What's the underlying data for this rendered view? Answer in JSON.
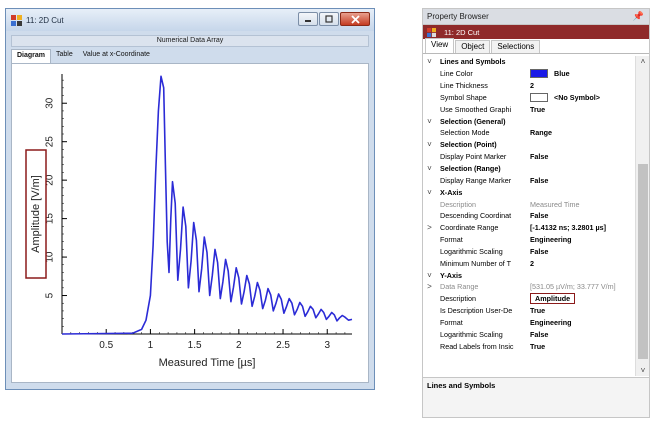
{
  "window": {
    "title": "11: 2D Cut",
    "subtitle": "Numerical Data Array",
    "tabs": [
      "Diagram",
      "Table",
      "Value at x-Coordinate"
    ],
    "active_tab": 0
  },
  "chart_data": {
    "type": "line",
    "xlabel": "Measured Time [µs]",
    "ylabel": "Amplitude [V/m]",
    "xlim": [
      0.0,
      3.28
    ],
    "ylim": [
      0.0,
      33.8
    ],
    "xticks": [
      "0.5",
      "1",
      "1.5",
      "2",
      "2.5",
      "3"
    ],
    "xtick_values": [
      0.5,
      1,
      1.5,
      2,
      2.5,
      3
    ],
    "yticks": [
      "5",
      "10",
      "15",
      "20",
      "25",
      "30"
    ],
    "ytick_values": [
      5,
      10,
      15,
      20,
      25,
      30
    ],
    "series": [
      {
        "color": "#2b2bd6",
        "x": [
          0.0,
          0.8,
          0.9,
          0.95,
          1.0,
          1.03,
          1.06,
          1.09,
          1.12,
          1.15,
          1.17,
          1.19,
          1.21,
          1.23,
          1.25,
          1.28,
          1.31,
          1.34,
          1.37,
          1.4,
          1.43,
          1.46,
          1.49,
          1.52,
          1.55,
          1.58,
          1.61,
          1.64,
          1.67,
          1.7,
          1.73,
          1.76,
          1.79,
          1.82,
          1.85,
          1.88,
          1.91,
          1.94,
          1.97,
          2.0,
          2.03,
          2.06,
          2.09,
          2.12,
          2.15,
          2.18,
          2.21,
          2.24,
          2.27,
          2.3,
          2.33,
          2.36,
          2.39,
          2.42,
          2.45,
          2.48,
          2.51,
          2.54,
          2.57,
          2.6,
          2.63,
          2.66,
          2.69,
          2.72,
          2.75,
          2.78,
          2.81,
          2.84,
          2.87,
          2.9,
          2.93,
          2.96,
          2.99,
          3.02,
          3.05,
          3.08,
          3.11,
          3.14,
          3.17,
          3.2,
          3.24,
          3.28
        ],
        "y": [
          0.0,
          0.1,
          0.6,
          1.8,
          5.0,
          11.5,
          21.0,
          29.0,
          33.5,
          32.0,
          22.0,
          12.0,
          8.0,
          15.0,
          19.8,
          17.0,
          7.0,
          11.0,
          16.5,
          14.0,
          6.0,
          9.5,
          14.5,
          12.2,
          5.5,
          8.5,
          12.6,
          10.6,
          5.0,
          7.6,
          11.0,
          9.3,
          4.6,
          6.8,
          9.7,
          8.2,
          4.2,
          6.1,
          8.6,
          7.3,
          3.9,
          5.5,
          7.6,
          6.5,
          3.6,
          4.9,
          6.7,
          5.7,
          3.3,
          4.4,
          5.9,
          5.1,
          3.0,
          4.0,
          5.2,
          4.5,
          2.7,
          3.6,
          4.6,
          4.0,
          2.5,
          3.2,
          4.1,
          3.6,
          2.3,
          2.9,
          3.6,
          3.2,
          2.1,
          2.6,
          3.2,
          2.8,
          1.9,
          2.3,
          2.8,
          2.5,
          1.7,
          2.1,
          2.4,
          2.2,
          1.8,
          1.9
        ]
      }
    ]
  },
  "property_browser": {
    "title": "Property Browser",
    "pin": "📌",
    "object_name": "11: 2D Cut",
    "tabs": [
      "View",
      "Object",
      "Selections"
    ],
    "active_tab": 0,
    "rows": [
      {
        "kind": "cat",
        "exp": "˅",
        "name": "Lines and Symbols"
      },
      {
        "kind": "prop",
        "name": "Line Color",
        "value": "Blue",
        "swatch": "#1a1ae6"
      },
      {
        "kind": "prop",
        "name": "Line Thickness",
        "value": "2"
      },
      {
        "kind": "prop",
        "name": "Symbol Shape",
        "value": "<No Symbol>",
        "swatch": "#ffffff"
      },
      {
        "kind": "prop",
        "name": "Use Smoothed Graphi",
        "value": "True"
      },
      {
        "kind": "cat",
        "exp": "˅",
        "name": "Selection (General)"
      },
      {
        "kind": "prop",
        "name": "Selection Mode",
        "value": "Range"
      },
      {
        "kind": "cat",
        "exp": "˅",
        "name": "Selection (Point)"
      },
      {
        "kind": "prop",
        "name": "Display Point Marker",
        "value": "False"
      },
      {
        "kind": "cat",
        "exp": "˅",
        "name": "Selection (Range)"
      },
      {
        "kind": "prop",
        "name": "Display Range Marker",
        "value": "False"
      },
      {
        "kind": "cat",
        "exp": "˅",
        "name": "X-Axis"
      },
      {
        "kind": "dim",
        "name": "Description",
        "value": "Measured Time"
      },
      {
        "kind": "prop",
        "name": "Descending Coordinat",
        "value": "False"
      },
      {
        "kind": "prop",
        "exp": ">",
        "name": "Coordinate Range",
        "value": "[-1.4132 ns; 3.2801 µs]"
      },
      {
        "kind": "prop",
        "name": "Format",
        "value": "Engineering"
      },
      {
        "kind": "prop",
        "name": "Logarithmic Scaling",
        "value": "False"
      },
      {
        "kind": "prop",
        "name": "Minimum Number of T",
        "value": "2"
      },
      {
        "kind": "cat",
        "exp": "˅",
        "name": "Y-Axis"
      },
      {
        "kind": "dim",
        "exp": ">",
        "name": "Data Range",
        "value": "[531.05 µV/m; 33.777 V/m]"
      },
      {
        "kind": "prop",
        "name": "Description",
        "value": "Amplitude",
        "highlight": true
      },
      {
        "kind": "prop",
        "name": "Is Description User-De",
        "value": "True"
      },
      {
        "kind": "prop",
        "name": "Format",
        "value": "Engineering"
      },
      {
        "kind": "prop",
        "name": "Logarithmic Scaling",
        "value": "False"
      },
      {
        "kind": "prop",
        "name": "Read Labels from Insic",
        "value": "True"
      }
    ],
    "description_title": "Lines and Symbols"
  }
}
